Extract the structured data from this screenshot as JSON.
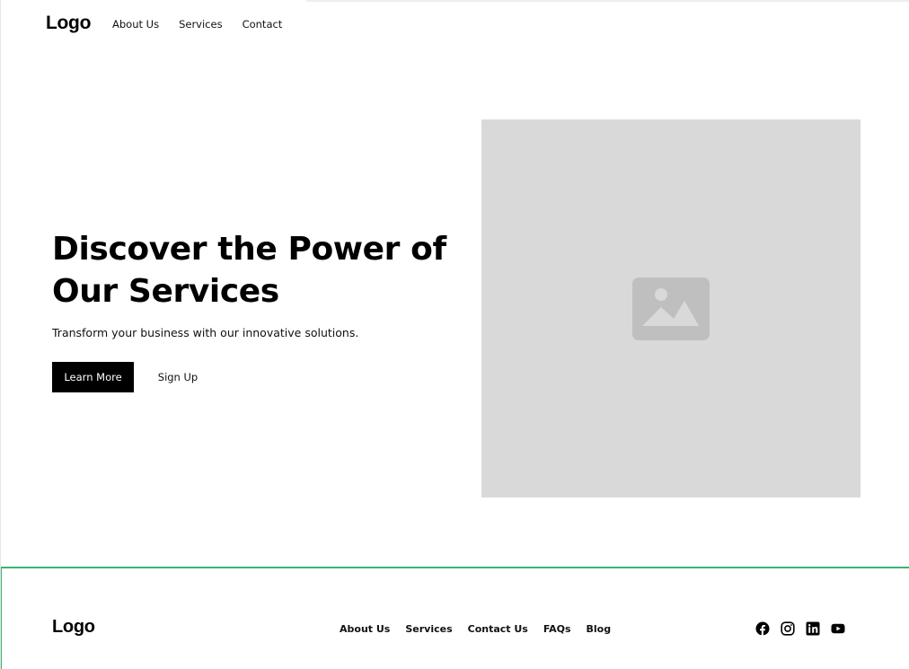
{
  "header": {
    "logo": "Logo",
    "nav": [
      "About Us",
      "Services",
      "Contact"
    ]
  },
  "hero": {
    "title_line1": "Discover the Power of",
    "title_line2": "Our Services",
    "subtitle": "Transform your business with our innovative solutions.",
    "primary_button": "Learn More",
    "secondary_button": "Sign Up",
    "image_icon": "image-placeholder-icon"
  },
  "footer": {
    "logo": "Logo",
    "links": [
      "About Us",
      "Services",
      "Contact Us",
      "FAQs",
      "Blog"
    ],
    "socials": [
      "facebook-icon",
      "instagram-icon",
      "linkedin-icon",
      "youtube-icon"
    ]
  },
  "colors": {
    "accent_border": "#3cb371",
    "placeholder_bg": "#d9d9d9",
    "placeholder_icon": "#bfbfbf",
    "button_bg": "#000000"
  }
}
